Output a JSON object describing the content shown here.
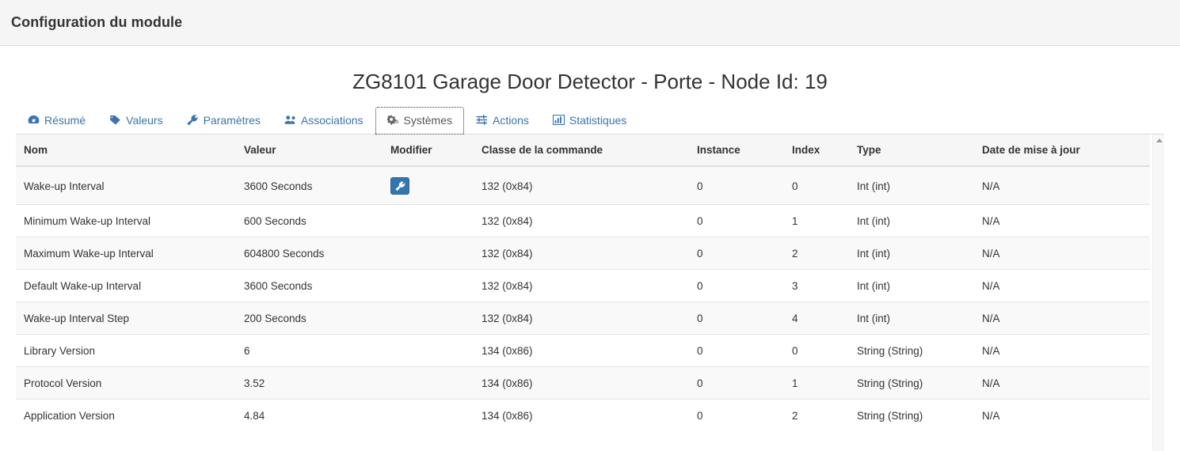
{
  "topbar": {
    "title": "Configuration du module"
  },
  "device": {
    "title": "ZG8101 Garage Door Detector - Porte - Node Id: 19"
  },
  "tabs": [
    {
      "label": "Résumé",
      "icon": "dashboard-icon",
      "active": false
    },
    {
      "label": "Valeurs",
      "icon": "tag-icon",
      "active": false
    },
    {
      "label": "Paramètres",
      "icon": "wrench-icon",
      "active": false
    },
    {
      "label": "Associations",
      "icon": "users-icon",
      "active": false
    },
    {
      "label": "Systèmes",
      "icon": "gears-icon",
      "active": true
    },
    {
      "label": "Actions",
      "icon": "sliders-icon",
      "active": false
    },
    {
      "label": "Statistiques",
      "icon": "bar-chart-icon",
      "active": false
    }
  ],
  "table": {
    "columns": [
      "Nom",
      "Valeur",
      "Modifier",
      "Classe de la commande",
      "Instance",
      "Index",
      "Type",
      "Date de mise à jour"
    ],
    "rows": [
      {
        "nom": "Wake-up Interval",
        "valeur": "3600 Seconds",
        "modifier": "wrench-icon",
        "classe": "132 (0x84)",
        "instance": "0",
        "index": "0",
        "type": "Int (int)",
        "date": "N/A"
      },
      {
        "nom": "Minimum Wake-up Interval",
        "valeur": "600 Seconds",
        "modifier": "",
        "classe": "132 (0x84)",
        "instance": "0",
        "index": "1",
        "type": "Int (int)",
        "date": "N/A"
      },
      {
        "nom": "Maximum Wake-up Interval",
        "valeur": "604800 Seconds",
        "modifier": "",
        "classe": "132 (0x84)",
        "instance": "0",
        "index": "2",
        "type": "Int (int)",
        "date": "N/A"
      },
      {
        "nom": "Default Wake-up Interval",
        "valeur": "3600 Seconds",
        "modifier": "",
        "classe": "132 (0x84)",
        "instance": "0",
        "index": "3",
        "type": "Int (int)",
        "date": "N/A"
      },
      {
        "nom": "Wake-up Interval Step",
        "valeur": "200 Seconds",
        "modifier": "",
        "classe": "132 (0x84)",
        "instance": "0",
        "index": "4",
        "type": "Int (int)",
        "date": "N/A"
      },
      {
        "nom": "Library Version",
        "valeur": "6",
        "modifier": "",
        "classe": "134 (0x86)",
        "instance": "0",
        "index": "0",
        "type": "String (String)",
        "date": "N/A"
      },
      {
        "nom": "Protocol Version",
        "valeur": "3.52",
        "modifier": "",
        "classe": "134 (0x86)",
        "instance": "0",
        "index": "1",
        "type": "String (String)",
        "date": "N/A"
      },
      {
        "nom": "Application Version",
        "valeur": "4.84",
        "modifier": "",
        "classe": "134 (0x86)",
        "instance": "0",
        "index": "2",
        "type": "String (String)",
        "date": "N/A"
      }
    ]
  },
  "scrollbar": {
    "up_arrow": "caret-up-icon"
  },
  "colors": {
    "accent": "#3276b1",
    "tab_link": "#3a74ad",
    "topbar_bg": "#f5f5f5",
    "header_bg": "#f6f6f6",
    "stripe_bg": "#f9f9f9"
  }
}
